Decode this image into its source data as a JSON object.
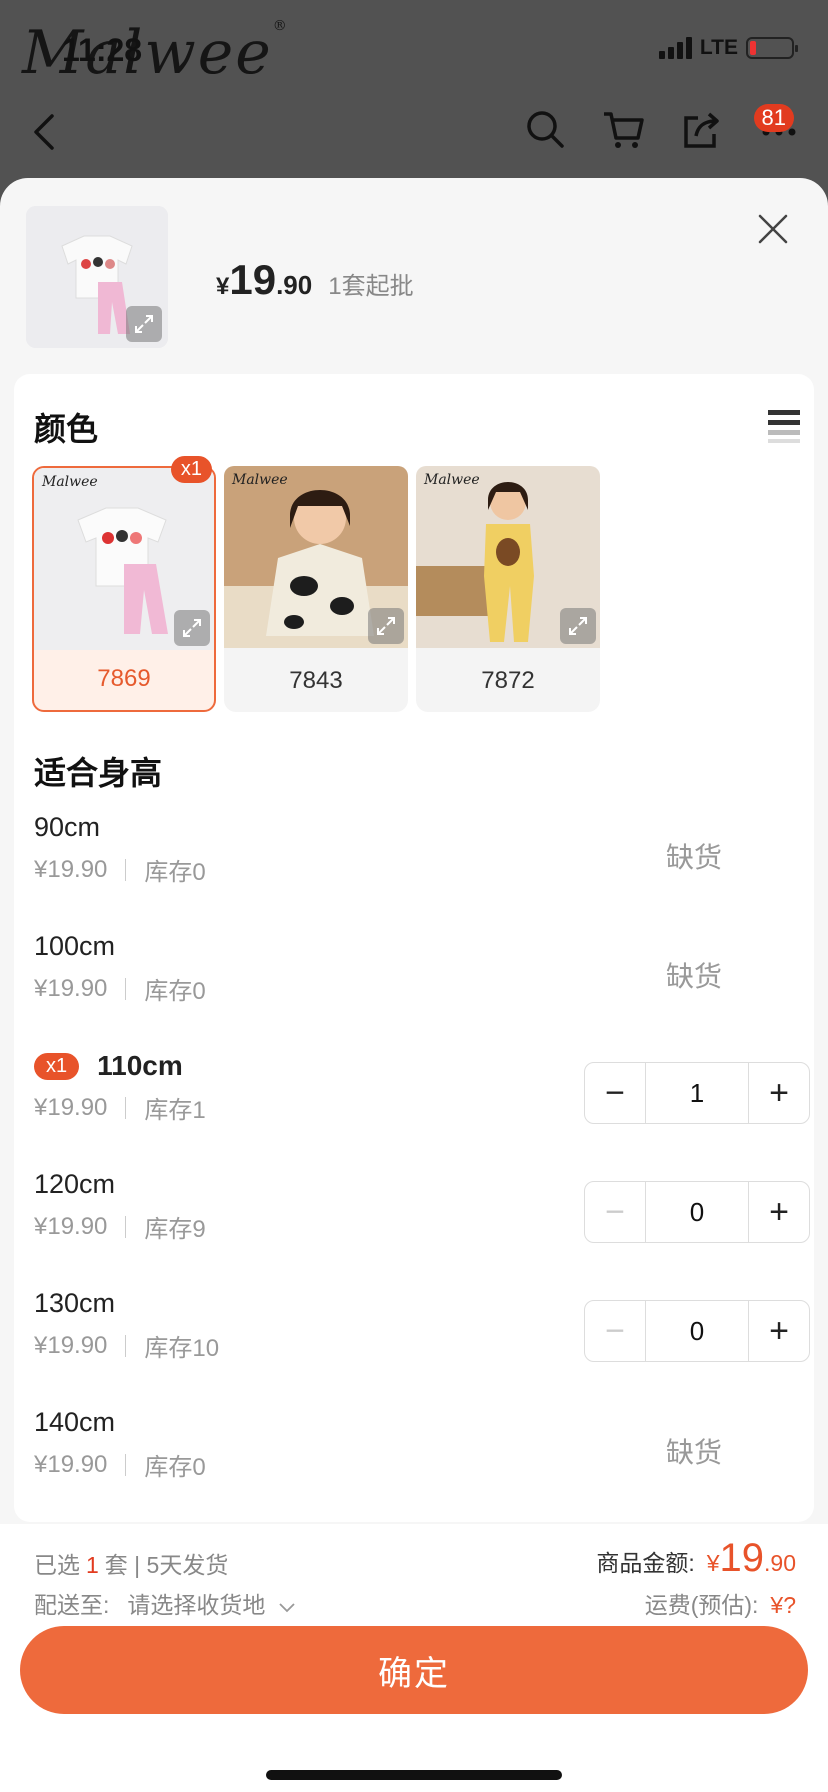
{
  "status": {
    "time": "11:28",
    "network": "LTE"
  },
  "brand": {
    "logo_text": "Malwee",
    "reg": "®"
  },
  "nav": {
    "cart_badge": "81"
  },
  "sheet": {
    "price": {
      "currency": "¥",
      "integer": "19",
      "decimal": ".90",
      "moq": "1套起批"
    }
  },
  "color_section": {
    "title": "颜色",
    "options": [
      {
        "label": "7869",
        "selected": true,
        "badge": "x1"
      },
      {
        "label": "7843",
        "selected": false
      },
      {
        "label": "7872",
        "selected": false
      }
    ]
  },
  "size_section": {
    "title": "适合身高",
    "rows": [
      {
        "name": "90cm",
        "price": "¥19.90",
        "stock": "库存0",
        "status": "缺货"
      },
      {
        "name": "100cm",
        "price": "¥19.90",
        "stock": "库存0",
        "status": "缺货"
      },
      {
        "name": "110cm",
        "badge": "x1",
        "price": "¥19.90",
        "stock": "库存1",
        "qty": "1"
      },
      {
        "name": "120cm",
        "price": "¥19.90",
        "stock": "库存9",
        "qty": "0"
      },
      {
        "name": "130cm",
        "price": "¥19.90",
        "stock": "库存10",
        "qty": "0"
      },
      {
        "name": "140cm",
        "price": "¥19.90",
        "stock": "库存0",
        "status": "缺货"
      }
    ]
  },
  "footer": {
    "selected_prefix": "已选",
    "selected_count": "1",
    "selected_suffix": "套 | 5天发货",
    "ship_to_label": "配送至:",
    "ship_to_value": "请选择收货地",
    "amount_label": "商品金额:",
    "amount_currency": "¥",
    "amount_int": "19",
    "amount_dec": ".90",
    "freight_label": "运费(预估):",
    "freight_value": "¥?",
    "confirm_label": "确定"
  },
  "colors": {
    "accent": "#ee6a3c",
    "badge": "#e8532a",
    "price_red": "#e23b1f"
  }
}
